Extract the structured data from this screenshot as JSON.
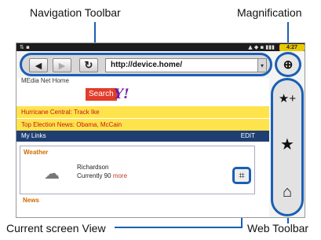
{
  "callouts": {
    "navigation_toolbar": "Navigation Toolbar",
    "magnification": "Magnification",
    "current_screen_view": "Current screen View",
    "web_toolbar": "Web Toolbar"
  },
  "statusbar": {
    "time": "4:27"
  },
  "toolbar": {
    "back_icon": "◀",
    "forward_icon": "▶",
    "refresh_icon": "↻",
    "url": "http://device.home/",
    "dropdown_icon": "▾"
  },
  "magnification": {
    "icon": "⊕"
  },
  "web_toolbar": {
    "favorites_icon": "★+",
    "bookmark_icon": "★",
    "home_icon": "⌂"
  },
  "page": {
    "header_text": "MEdia Net Home",
    "search_label": "Search",
    "yahoo_logo": "Y!",
    "news": [
      "Hurricane Central: Track Ike",
      "Top Election News: Obama, McCain"
    ],
    "my_links": "My Links",
    "edit": "EDIT",
    "weather": {
      "title": "Weather",
      "city": "Richardson",
      "current": "Currently 90",
      "more": "more"
    },
    "news_label": "News"
  },
  "colors": {
    "accent": "#1a5fb4",
    "news_bg": "#ffe34c",
    "news_text": "#c41616",
    "links_bar": "#1f3f73",
    "search_btn": "#e23c2a"
  }
}
